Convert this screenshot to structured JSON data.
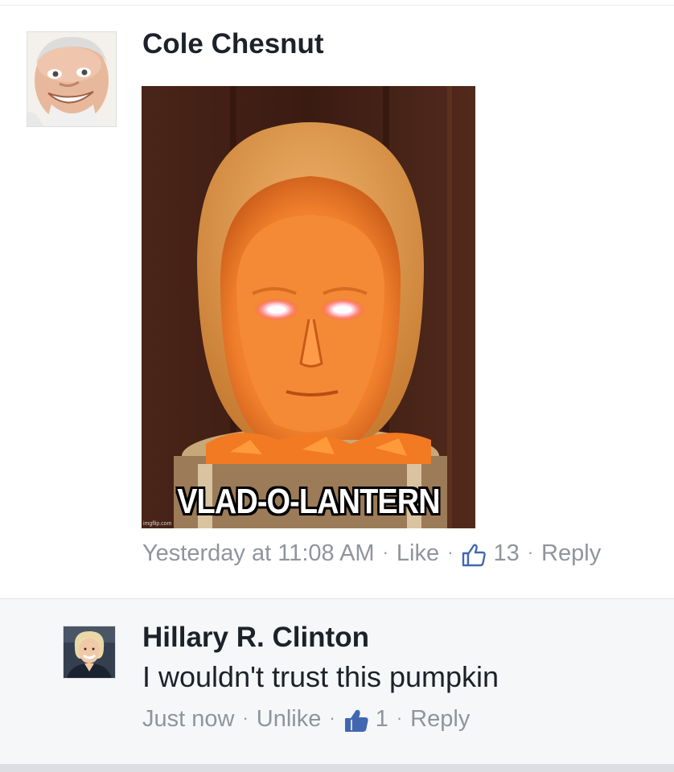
{
  "comments": [
    {
      "author": "Cole Chesnut",
      "avatar_icon": "old-man-avatar",
      "image": {
        "caption": "VLAD-O-LANTERN",
        "watermark": "imgflip.com"
      },
      "timestamp": "Yesterday at 11:08 AM",
      "like_label": "Like",
      "like_count": "13",
      "reply_label": "Reply"
    },
    {
      "author": "Hillary R. Clinton",
      "avatar_icon": "woman-avatar",
      "text": "I wouldn't trust this pumpkin",
      "timestamp": "Just now",
      "like_label": "Unlike",
      "like_count": "1",
      "reply_label": "Reply"
    }
  ],
  "colors": {
    "name": "#1d2129",
    "meta": "#90949c",
    "like_blue": "#4267b2",
    "reply_bg": "#f6f7f9"
  },
  "separator": "·"
}
